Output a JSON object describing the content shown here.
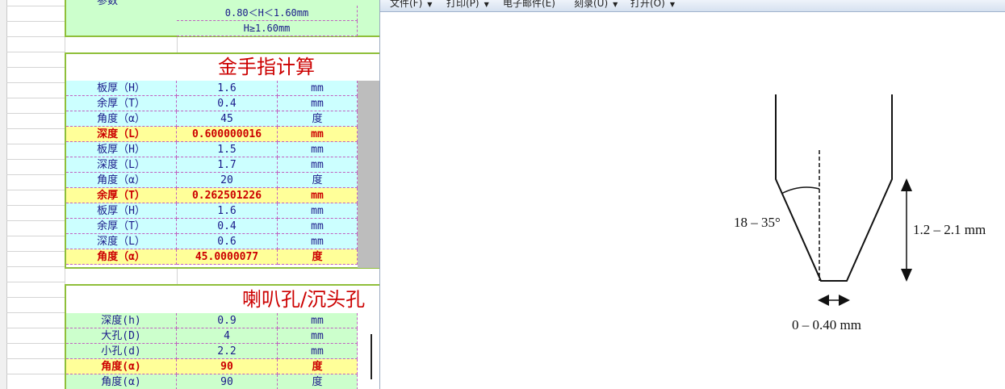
{
  "spreadsheet": {
    "top_block": {
      "cut_label": "参数",
      "rows": [
        "0.80＜H＜1.60mm",
        "H≥1.60mm"
      ]
    },
    "gold_finger": {
      "title": "金手指计算",
      "rows": [
        {
          "label": "板厚（H）",
          "value": "1.6",
          "unit": "mm",
          "kind": "blue"
        },
        {
          "label": "余厚（T）",
          "value": "0.4",
          "unit": "mm",
          "kind": "blue"
        },
        {
          "label": "角度（α）",
          "value": "45",
          "unit": "度",
          "kind": "blue"
        },
        {
          "label": "深度（L）",
          "value": "0.600000016",
          "unit": "mm",
          "kind": "yellow"
        },
        {
          "label": "板厚（H）",
          "value": "1.5",
          "unit": "mm",
          "kind": "blue"
        },
        {
          "label": "深度（L）",
          "value": "1.7",
          "unit": "mm",
          "kind": "blue"
        },
        {
          "label": "角度（α）",
          "value": "20",
          "unit": "度",
          "kind": "blue"
        },
        {
          "label": "余厚（T）",
          "value": "0.262501226",
          "unit": "mm",
          "kind": "yellow"
        },
        {
          "label": "板厚（H）",
          "value": "1.6",
          "unit": "mm",
          "kind": "blue"
        },
        {
          "label": "余厚（T）",
          "value": "0.4",
          "unit": "mm",
          "kind": "blue"
        },
        {
          "label": "深度（L）",
          "value": "0.6",
          "unit": "mm",
          "kind": "blue"
        },
        {
          "label": "角度（α）",
          "value": "45.0000077",
          "unit": "度",
          "kind": "yellow"
        }
      ]
    },
    "countersink": {
      "title": "喇叭孔/沉头孔",
      "rows": [
        {
          "label": "深度(h)",
          "value": "0.9",
          "unit": "mm",
          "kind": "green"
        },
        {
          "label": "大孔(D)",
          "value": "4",
          "unit": "mm",
          "kind": "green"
        },
        {
          "label": "小孔(d)",
          "value": "2.2",
          "unit": "mm",
          "kind": "green"
        },
        {
          "label": "角度(α)",
          "value": "90",
          "unit": "度",
          "kind": "yellow"
        },
        {
          "label": "角度(α)",
          "value": "90",
          "unit": "度",
          "kind": "green"
        }
      ]
    }
  },
  "viewer": {
    "menu": [
      "文件(F)",
      "打印(P)",
      "电子邮件(E)",
      "刻录(U)",
      "打开(O)"
    ],
    "diagram": {
      "angle_label": "18 – 35°",
      "height_label": "1.2 – 2.1 mm",
      "width_label": "0 – 0.40 mm"
    }
  }
}
